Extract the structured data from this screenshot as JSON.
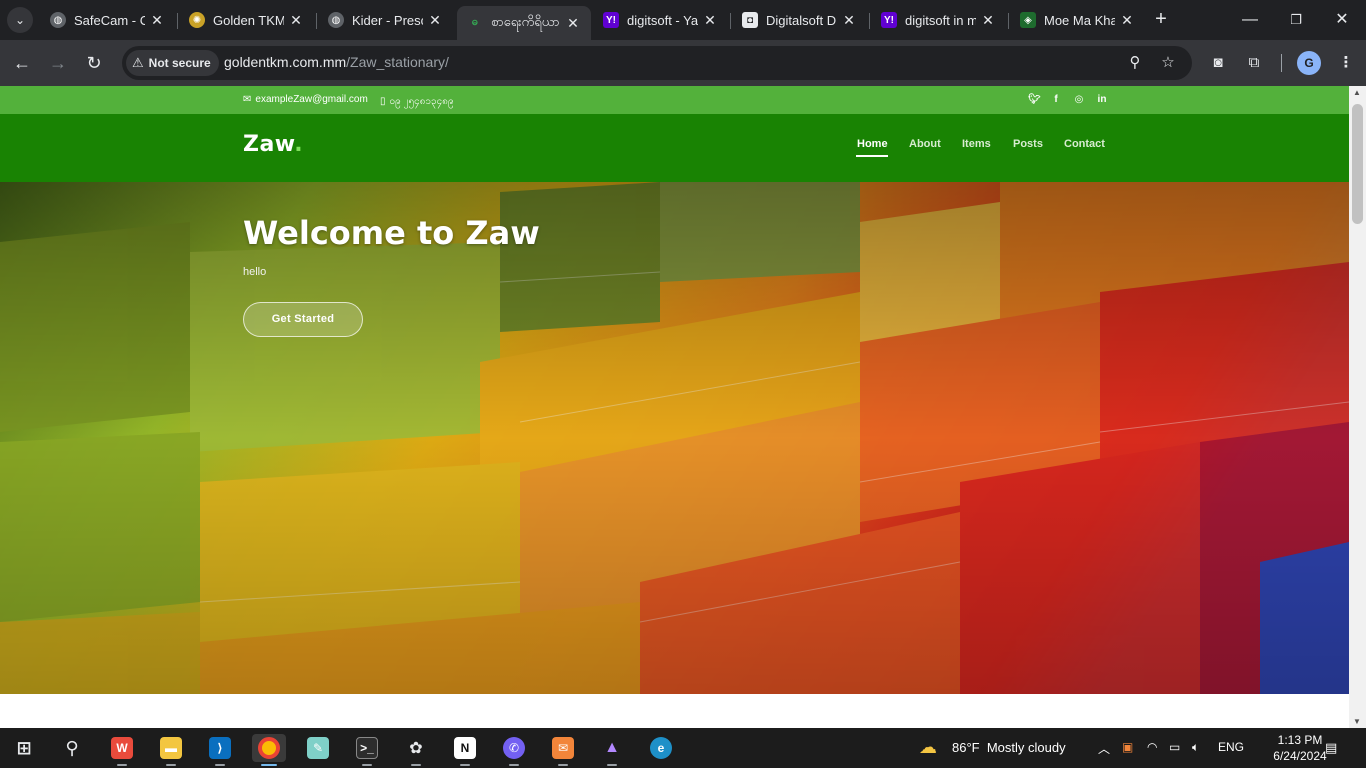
{
  "browser": {
    "tabs": [
      {
        "title": "SafeCam - C",
        "favicon_color": "#9aa0a6",
        "favicon": "globe-icon"
      },
      {
        "title": "Golden TKM",
        "favicon_color": "#c9a227",
        "favicon": "golden-tkm-icon"
      },
      {
        "title": "Kider - Presc",
        "favicon_color": "#9aa0a6",
        "favicon": "globe-icon"
      },
      {
        "title": "စာရေးကိရိယာ",
        "favicon_color": "#34a853",
        "favicon": "stationary-icon",
        "active": true
      },
      {
        "title": "digitsoft - Ya",
        "favicon_color": "#6001d2",
        "favicon": "yahoo-icon"
      },
      {
        "title": "Digitalsoft D",
        "favicon_color": "#e8eaed",
        "favicon": "digitalsoft-icon"
      },
      {
        "title": "digitsoft in m",
        "favicon_color": "#6001d2",
        "favicon": "yahoo-icon"
      },
      {
        "title": "Moe Ma Kha",
        "favicon_color": "#34a853",
        "favicon": "moe-ma-kha-icon"
      }
    ],
    "security_label": "Not secure",
    "url_host": "goldentkm.com.mm",
    "url_path": "/Zaw_stationary/",
    "yahoo_glyph": "Y!",
    "profile_initial": "G"
  },
  "site": {
    "email": "exampleZaw@gmail.com",
    "phone": "၀၉ ၂၅၄၈၁၃၄၈၉",
    "brand": "Zaw",
    "brand_dot": ".",
    "nav": [
      "Home",
      "About",
      "Items",
      "Posts",
      "Contact"
    ],
    "hero_title": "Welcome to Zaw",
    "hero_subtitle": "hello",
    "hero_button": "Get Started",
    "accent_top": "#53b13b",
    "accent_nav": "#198303"
  },
  "taskbar": {
    "weather_temp": "86°F",
    "weather_desc": "Mostly cloudy",
    "lang": "ENG",
    "time": "1:13 PM",
    "date": "6/24/2024"
  }
}
